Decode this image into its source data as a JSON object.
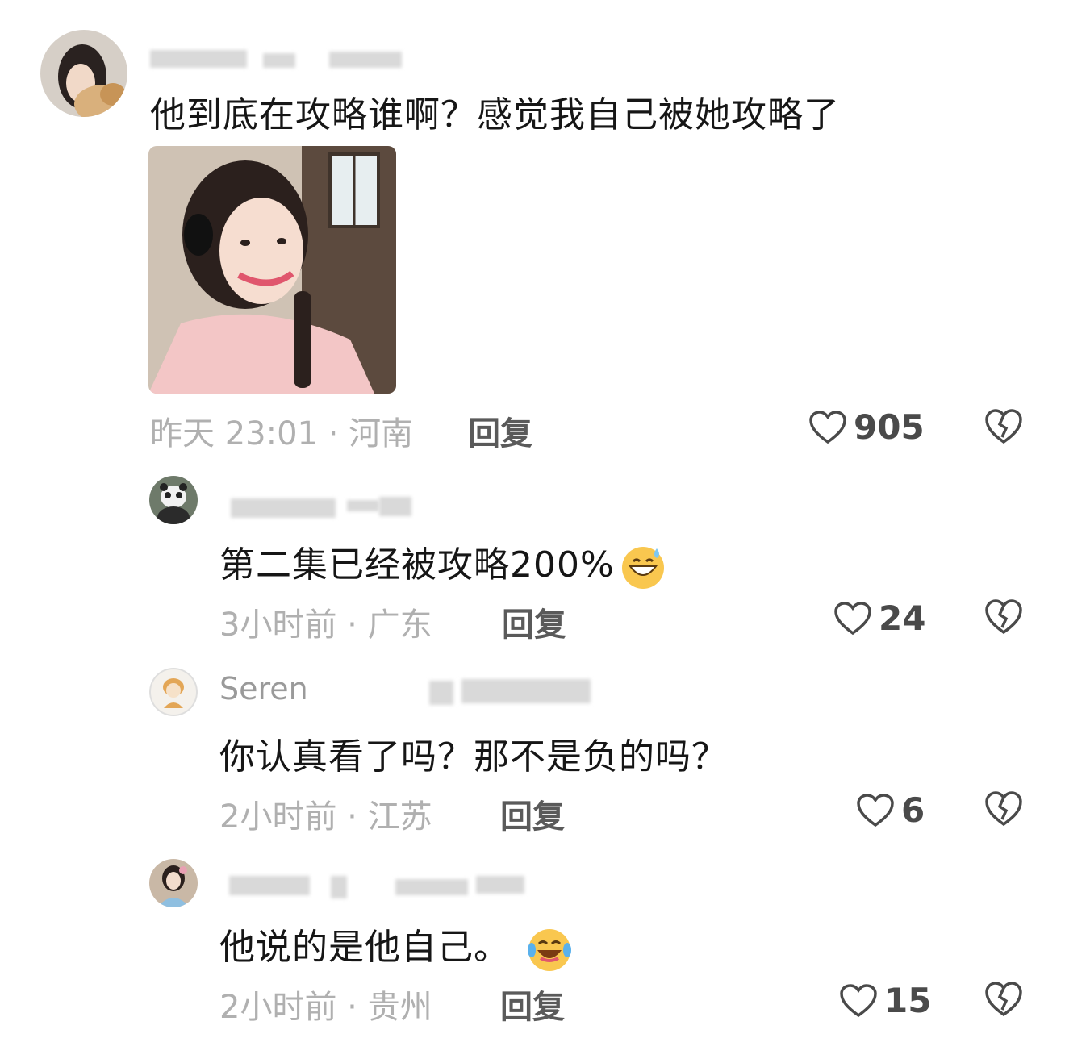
{
  "comments": [
    {
      "text": "他到底在攻略谁啊？感觉我自己被她攻略了",
      "time": "昨天 23:01",
      "location": "河南",
      "reply_label": "回复",
      "likes": "905"
    },
    {
      "text": "第二集已经被攻略200%",
      "time": "3小时前",
      "location": "广东",
      "reply_label": "回复",
      "likes": "24"
    },
    {
      "name": "Seren",
      "text": "你认真看了吗？那不是负的吗？",
      "time": "2小时前",
      "location": "江苏",
      "reply_label": "回复",
      "likes": "6"
    },
    {
      "text": "他说的是他自己。",
      "time": "2小时前",
      "location": "贵州",
      "reply_label": "回复",
      "likes": "15"
    }
  ],
  "separator": " · ",
  "colors": {
    "text": "#161616",
    "meta": "#b0b0b0",
    "reply": "#5a5a5a",
    "like": "#4a4a4a"
  },
  "icons": {
    "like": "heart-icon",
    "dislike": "broken-heart-icon"
  }
}
